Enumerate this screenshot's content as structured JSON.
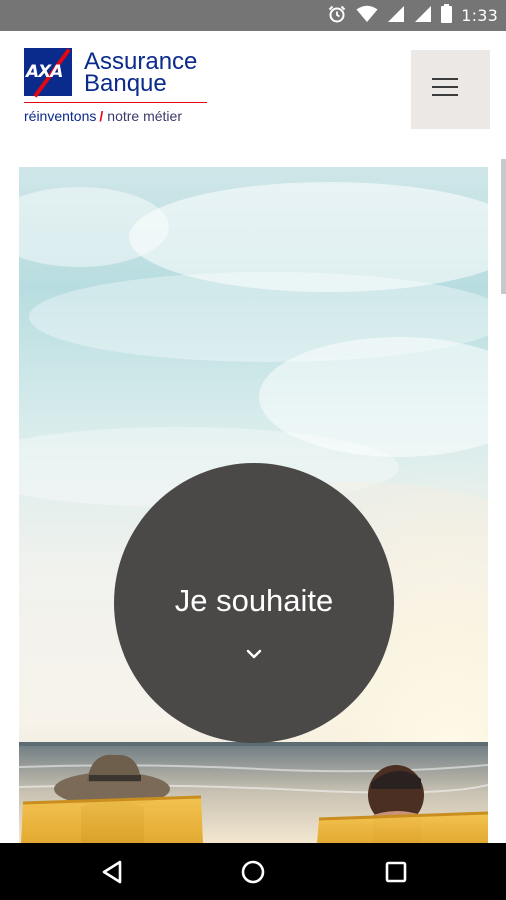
{
  "status_bar": {
    "time": "1:33",
    "icons": [
      "alarm-icon",
      "wifi-icon",
      "signal-icon",
      "signal-icon",
      "battery-icon"
    ]
  },
  "header": {
    "logo": {
      "mark": "AXA",
      "title_line1": "Assurance",
      "title_line2": "Banque",
      "tagline_part1": "réinventons",
      "tagline_part2": "notre métier"
    },
    "menu_icon": "hamburger-menu-icon"
  },
  "hero": {
    "cta_label": "Je souhaite",
    "cta_icon": "chevron-down-icon"
  },
  "nav_bar": {
    "icons": [
      "back-icon",
      "home-icon",
      "recents-icon"
    ]
  },
  "colors": {
    "brand_blue": "#0a2a8c",
    "brand_red": "#e30613",
    "cta_circle": "#4a4948",
    "menu_bg": "#ece8e6",
    "status_bar": "#757575"
  }
}
